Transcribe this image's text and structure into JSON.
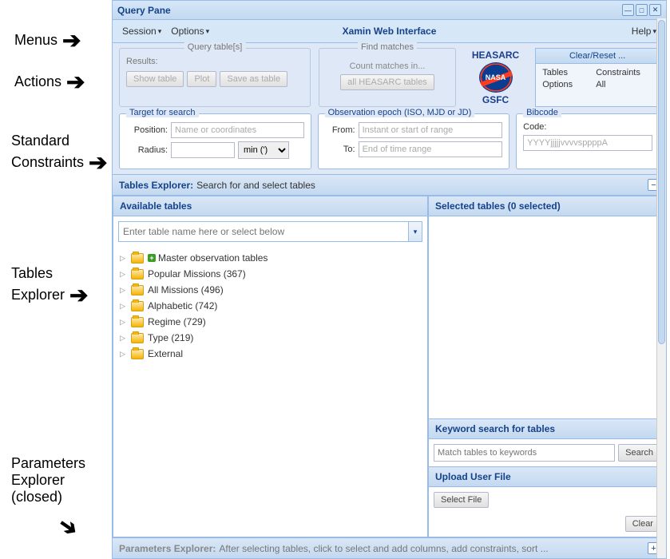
{
  "annotations": {
    "menus": "Menus",
    "actions": "Actions",
    "constraints_l1": "Standard",
    "constraints_l2": "Constraints",
    "tables_l1": "Tables",
    "tables_l2": "Explorer",
    "params_l1": "Parameters",
    "params_l2": "Explorer",
    "params_l3": "(closed)"
  },
  "titlebar": {
    "title": "Query Pane"
  },
  "menubar": {
    "session": "Session",
    "options": "Options",
    "center": "Xamin Web Interface",
    "help": "Help"
  },
  "actions": {
    "query_title": "Query table[s]",
    "results_label": "Results:",
    "show_table": "Show table",
    "plot": "Plot",
    "save_as_table": "Save as table",
    "find_title": "Find matches",
    "count_sub": "Count matches in...",
    "all_heasarc": "all HEASARC tables",
    "logo_top": "HEASARC",
    "logo_mid": "NASA",
    "logo_bot": "GSFC",
    "clear_head": "Clear/Reset ...",
    "clear_tables": "Tables",
    "clear_constraints": "Constraints",
    "clear_options": "Options",
    "clear_all": "All"
  },
  "constraints": {
    "target_title": "Target for search",
    "position_label": "Position:",
    "position_ph": "Name or coordinates",
    "radius_label": "Radius:",
    "radius_unit": "min (')",
    "epoch_title": "Observation epoch (ISO, MJD or JD)",
    "from_label": "From:",
    "from_ph": "Instant or start of range",
    "to_label": "To:",
    "to_ph": "End of time range",
    "bibcode_title": "Bibcode",
    "code_label": "Code:",
    "code_ph": "YYYYjjjjjvvvvsppppA"
  },
  "tables_explorer": {
    "bar_title": "Tables Explorer:",
    "bar_sub": "Search for and select tables",
    "available_head": "Available tables",
    "combo_ph": "Enter table name here or select below",
    "selected_head": "Selected tables (0 selected)",
    "tree": [
      {
        "label": "Master observation tables",
        "plus": true
      },
      {
        "label": "Popular Missions (367)",
        "plus": false
      },
      {
        "label": "All Missions (496)",
        "plus": false
      },
      {
        "label": "Alphabetic (742)",
        "plus": false
      },
      {
        "label": "Regime (729)",
        "plus": false
      },
      {
        "label": "Type (219)",
        "plus": false
      },
      {
        "label": "External",
        "plus": false
      }
    ],
    "keyword_head": "Keyword search for tables",
    "keyword_ph": "Match tables to keywords",
    "search_btn": "Search",
    "upload_head": "Upload User File",
    "select_file": "Select File",
    "clear_btn": "Clear"
  },
  "params_bar": {
    "title": "Parameters Explorer:",
    "sub": "After selecting tables, click to select and add columns, add constraints, sort ..."
  }
}
